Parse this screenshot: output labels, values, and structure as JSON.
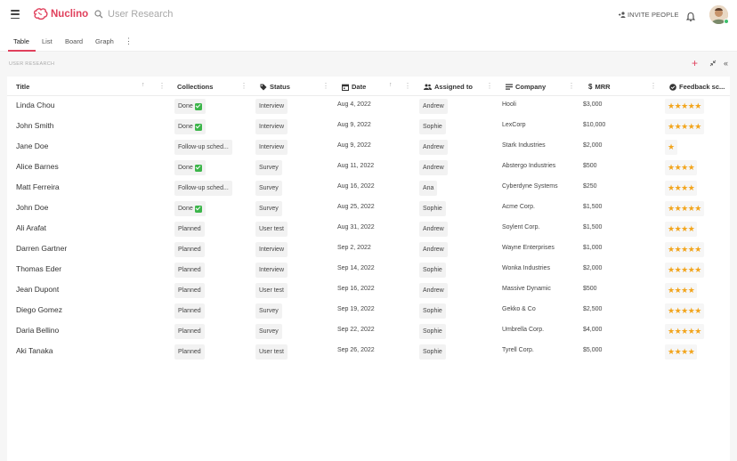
{
  "app": {
    "name": "Nuclino",
    "accent": "#e0405c"
  },
  "search": {
    "placeholder": "User Research"
  },
  "header": {
    "invite_label": "INVITE PEOPLE"
  },
  "tabs": [
    {
      "label": "Table",
      "active": true
    },
    {
      "label": "List"
    },
    {
      "label": "Board"
    },
    {
      "label": "Graph"
    }
  ],
  "section": {
    "label": "USER RESEARCH"
  },
  "columns": {
    "title": "Title",
    "collections": "Collections",
    "status": "Status",
    "date": "Date",
    "assigned": "Assigned to",
    "company": "Company",
    "mrr": "MRR",
    "feedback": "Feedback sc..."
  },
  "rows": [
    {
      "title": "Linda Chou",
      "collection": "Done",
      "done": true,
      "status": "Interview",
      "date": "Aug 4, 2022",
      "assigned": "Andrew",
      "company": "Hooli",
      "mrr": "$3,000",
      "stars": "★★★★★"
    },
    {
      "title": "John Smith",
      "collection": "Done",
      "done": true,
      "status": "Interview",
      "date": "Aug 9, 2022",
      "assigned": "Sophie",
      "company": "LexCorp",
      "mrr": "$10,000",
      "stars": "★★★★★"
    },
    {
      "title": "Jane Doe",
      "collection": "Follow-up sched...",
      "done": false,
      "status": "Interview",
      "date": "Aug 9, 2022",
      "assigned": "Andrew",
      "company": "Stark Industries",
      "mrr": "$2,000",
      "stars": "★"
    },
    {
      "title": "Alice Barnes",
      "collection": "Done",
      "done": true,
      "status": "Survey",
      "date": "Aug 11, 2022",
      "assigned": "Andrew",
      "company": "Abstergo Industries",
      "mrr": "$500",
      "stars": "★★★★"
    },
    {
      "title": "Matt Ferreira",
      "collection": "Follow-up sched...",
      "done": false,
      "status": "Survey",
      "date": "Aug 16, 2022",
      "assigned": "Ana",
      "company": "Cyberdyne Systems",
      "mrr": "$250",
      "stars": "★★★★"
    },
    {
      "title": "John Doe",
      "collection": "Done",
      "done": true,
      "status": "Survey",
      "date": "Aug 25, 2022",
      "assigned": "Sophie",
      "company": "Acme Corp.",
      "mrr": "$1,500",
      "stars": "★★★★★"
    },
    {
      "title": "Ali Arafat",
      "collection": "Planned",
      "done": false,
      "status": "User test",
      "date": "Aug 31, 2022",
      "assigned": "Andrew",
      "company": "Soylent Corp.",
      "mrr": "$1,500",
      "stars": "★★★★"
    },
    {
      "title": "Darren Gartner",
      "collection": "Planned",
      "done": false,
      "status": "Interview",
      "date": "Sep 2, 2022",
      "assigned": "Andrew",
      "company": "Wayne Enterprises",
      "mrr": "$1,000",
      "stars": "★★★★★"
    },
    {
      "title": "Thomas Eder",
      "collection": "Planned",
      "done": false,
      "status": "Interview",
      "date": "Sep 14, 2022",
      "assigned": "Sophie",
      "company": "Wonka Industries",
      "mrr": "$2,000",
      "stars": "★★★★★"
    },
    {
      "title": "Jean Dupont",
      "collection": "Planned",
      "done": false,
      "status": "User test",
      "date": "Sep 16, 2022",
      "assigned": "Andrew",
      "company": "Massive Dynamic",
      "mrr": "$500",
      "stars": "★★★★"
    },
    {
      "title": "Diego Gomez",
      "collection": "Planned",
      "done": false,
      "status": "Survey",
      "date": "Sep 19, 2022",
      "assigned": "Sophie",
      "company": "Gekko & Co",
      "mrr": "$2,500",
      "stars": "★★★★★"
    },
    {
      "title": "Daria Bellino",
      "collection": "Planned",
      "done": false,
      "status": "Survey",
      "date": "Sep 22, 2022",
      "assigned": "Sophie",
      "company": "Umbrella Corp.",
      "mrr": "$4,000",
      "stars": "★★★★★"
    },
    {
      "title": "Aki Tanaka",
      "collection": "Planned",
      "done": false,
      "status": "User test",
      "date": "Sep 26, 2022",
      "assigned": "Sophie",
      "company": "Tyrell Corp.",
      "mrr": "$5,000",
      "stars": "★★★★"
    }
  ]
}
